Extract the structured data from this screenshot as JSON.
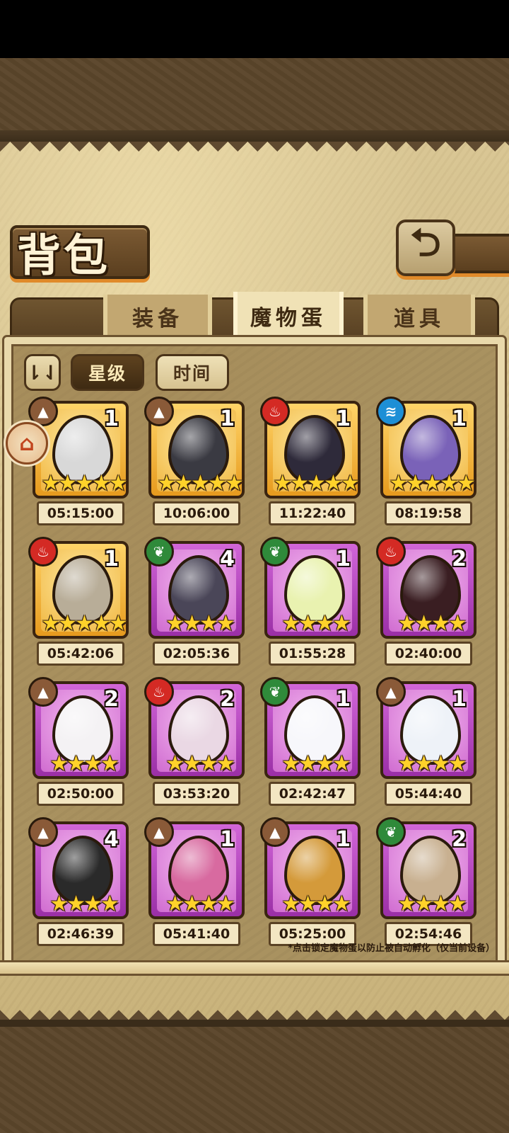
{
  "header": {
    "title": "背包",
    "back_icon": "return-arrow-icon"
  },
  "tabs": [
    {
      "label": "装备",
      "active": false
    },
    {
      "label": "魔物蛋",
      "active": true
    },
    {
      "label": "道具",
      "active": false
    }
  ],
  "sort": {
    "toggle_icon": "sort-order-icon",
    "toggle_symbol": "⇂⇃",
    "options": [
      {
        "label": "星级",
        "active": true
      },
      {
        "label": "时间",
        "active": false
      }
    ]
  },
  "lock_icon": "lock-toggle-icon",
  "eggs": [
    {
      "element": "earth",
      "count": "1",
      "stars": 5,
      "rarity": "gold",
      "timer": "05:15:00",
      "egg_color": "#d8d8d8"
    },
    {
      "element": "earth",
      "count": "1",
      "stars": 5,
      "rarity": "gold",
      "timer": "10:06:00",
      "egg_color": "#3a3a42"
    },
    {
      "element": "fire",
      "count": "1",
      "stars": 5,
      "rarity": "gold",
      "timer": "11:22:40",
      "egg_color": "#2e2a3a"
    },
    {
      "element": "water",
      "count": "1",
      "stars": 5,
      "rarity": "gold",
      "timer": "08:19:58",
      "egg_color": "#7a62b8"
    },
    {
      "element": "fire",
      "count": "1",
      "stars": 5,
      "rarity": "gold",
      "timer": "05:42:06",
      "egg_color": "#b8ad98"
    },
    {
      "element": "grass",
      "count": "4",
      "stars": 4,
      "rarity": "purple",
      "timer": "02:05:36",
      "egg_color": "#4a4658"
    },
    {
      "element": "grass",
      "count": "1",
      "stars": 4,
      "rarity": "purple",
      "timer": "01:55:28",
      "egg_color": "#e9f2b0"
    },
    {
      "element": "fire",
      "count": "2",
      "stars": 4,
      "rarity": "purple",
      "timer": "02:40:00",
      "egg_color": "#3a1e22"
    },
    {
      "element": "earth",
      "count": "2",
      "stars": 4,
      "rarity": "purple",
      "timer": "02:50:00",
      "egg_color": "#f4f2f4"
    },
    {
      "element": "fire",
      "count": "2",
      "stars": 4,
      "rarity": "purple",
      "timer": "03:53:20",
      "egg_color": "#ead8e4"
    },
    {
      "element": "grass",
      "count": "1",
      "stars": 4,
      "rarity": "purple",
      "timer": "02:42:47",
      "egg_color": "#f7f7fb"
    },
    {
      "element": "earth",
      "count": "1",
      "stars": 4,
      "rarity": "purple",
      "timer": "05:44:40",
      "egg_color": "#eef2f8"
    },
    {
      "element": "earth",
      "count": "4",
      "stars": 4,
      "rarity": "purple",
      "timer": "02:46:39",
      "egg_color": "#2a2a2a"
    },
    {
      "element": "earth",
      "count": "1",
      "stars": 4,
      "rarity": "purple",
      "timer": "05:41:40",
      "egg_color": "#d86aa0"
    },
    {
      "element": "earth",
      "count": "1",
      "stars": 4,
      "rarity": "purple",
      "timer": "05:25:00",
      "egg_color": "#d49a3a"
    },
    {
      "element": "grass",
      "count": "2",
      "stars": 4,
      "rarity": "purple",
      "timer": "02:54:46",
      "egg_color": "#c8b090"
    }
  ],
  "footnote": "*点击锁定魔物蛋以防止被自动孵化（仅当前设备）"
}
